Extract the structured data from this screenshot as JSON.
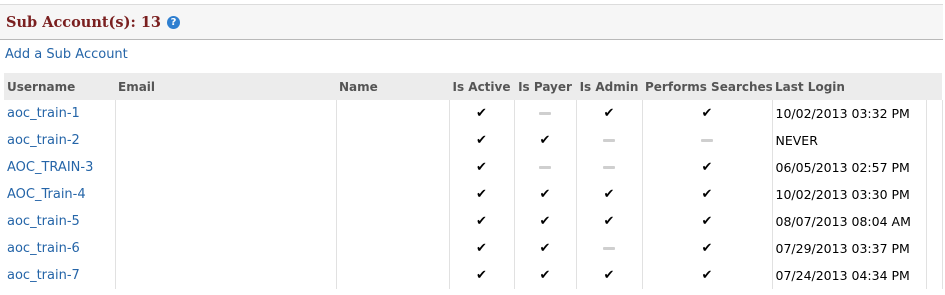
{
  "header": {
    "title": "Sub Account(s): 13",
    "help_icon": "?"
  },
  "add_link": "Add a Sub Account",
  "table": {
    "columns": [
      "Username",
      "Email",
      "Name",
      "Is Active",
      "Is Payer",
      "Is Admin",
      "Performs Searches",
      "Last Login"
    ],
    "rows": [
      {
        "username": "aoc_train-1",
        "email": "",
        "name": "",
        "is_active": true,
        "is_payer": false,
        "is_admin": true,
        "performs_searches": true,
        "last_login": "10/02/2013 03:32 PM"
      },
      {
        "username": "aoc_train-2",
        "email": "",
        "name": "",
        "is_active": true,
        "is_payer": true,
        "is_admin": false,
        "performs_searches": false,
        "last_login": "NEVER"
      },
      {
        "username": "AOC_TRAIN-3",
        "email": "",
        "name": "",
        "is_active": true,
        "is_payer": false,
        "is_admin": false,
        "performs_searches": true,
        "last_login": "06/05/2013 02:57 PM"
      },
      {
        "username": "AOC_Train-4",
        "email": "",
        "name": "",
        "is_active": true,
        "is_payer": true,
        "is_admin": true,
        "performs_searches": true,
        "last_login": "10/02/2013 03:30 PM"
      },
      {
        "username": "aoc_train-5",
        "email": "",
        "name": "",
        "is_active": true,
        "is_payer": true,
        "is_admin": true,
        "performs_searches": true,
        "last_login": "08/07/2013 08:04 AM"
      },
      {
        "username": "aoc_train-6",
        "email": "",
        "name": "",
        "is_active": true,
        "is_payer": true,
        "is_admin": false,
        "performs_searches": true,
        "last_login": "07/29/2013 03:37 PM"
      },
      {
        "username": "aoc_train-7",
        "email": "",
        "name": "",
        "is_active": true,
        "is_payer": true,
        "is_admin": true,
        "performs_searches": true,
        "last_login": "07/24/2013 04:34 PM"
      }
    ],
    "check_glyph": "✔",
    "icons": {
      "true": "check-icon",
      "false": "dash-icon"
    }
  },
  "colors": {
    "title": "#7a1f1f",
    "link": "#2565a8",
    "header_bg": "#ececec",
    "help_icon": "#2f7fd0"
  }
}
